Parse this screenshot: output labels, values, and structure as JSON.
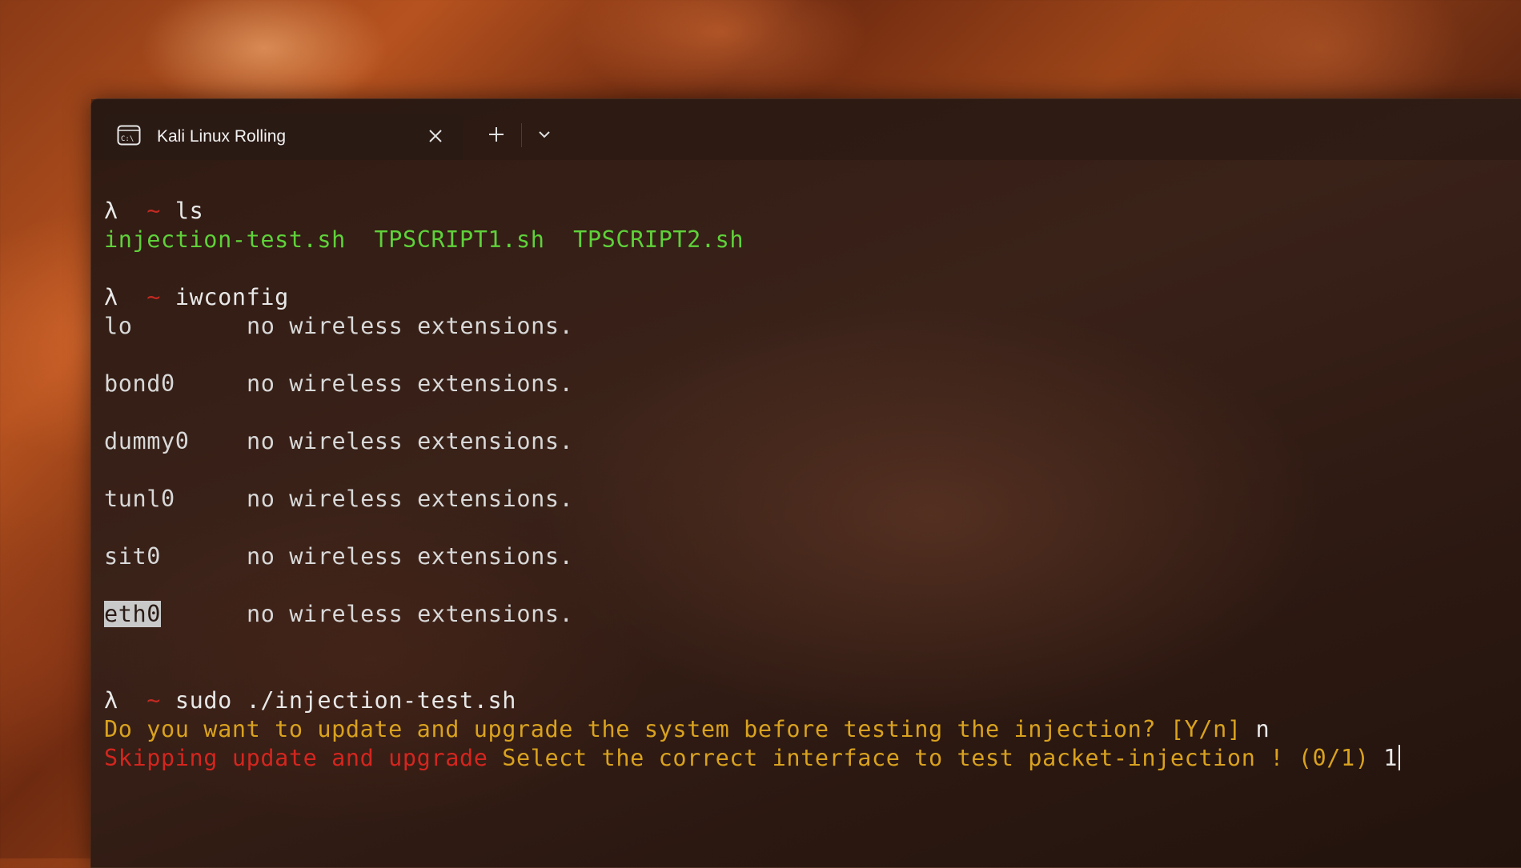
{
  "window": {
    "tab_title": "Kali Linux Rolling",
    "tab_icon": "terminal-icon",
    "close_icon": "close-icon",
    "new_tab_icon": "plus-icon",
    "dropdown_icon": "chevron-down-icon"
  },
  "terminal": {
    "prompt_symbol": "λ",
    "prompt_dir": "~",
    "cmd1": "ls",
    "ls_files": [
      "injection-test.sh",
      "TPSCRIPT1.sh",
      "TPSCRIPT2.sh"
    ],
    "cmd2": "iwconfig",
    "interfaces": [
      {
        "name": "lo",
        "status": "no wireless extensions."
      },
      {
        "name": "bond0",
        "status": "no wireless extensions."
      },
      {
        "name": "dummy0",
        "status": "no wireless extensions."
      },
      {
        "name": "tunl0",
        "status": "no wireless extensions."
      },
      {
        "name": "sit0",
        "status": "no wireless extensions."
      },
      {
        "name": "eth0",
        "status": "no wireless extensions."
      }
    ],
    "cmd3": "sudo ./injection-test.sh",
    "question": "Do you want to update and upgrade the system before testing the injection? [Y/n]",
    "answer": "n",
    "skip_msg": "Skipping update and upgrade",
    "select_msg": "Select the correct interface to test packet-injection ! (0/1)",
    "input": "1"
  },
  "colors": {
    "green": "#5fd13a",
    "yellow": "#d9a21f",
    "red": "#d3261f",
    "tilde": "#c42a22"
  }
}
